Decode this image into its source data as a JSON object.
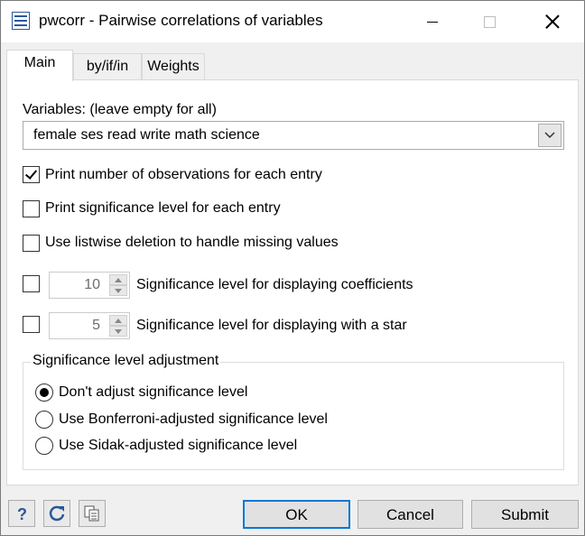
{
  "window": {
    "title": "pwcorr - Pairwise correlations of variables",
    "icons": [
      "app-icon",
      "minimize-icon",
      "maximize-icon",
      "close-icon"
    ]
  },
  "tabs": [
    {
      "label": "Main",
      "active": true
    },
    {
      "label": "by/if/in",
      "active": false
    },
    {
      "label": "Weights",
      "active": false
    }
  ],
  "main": {
    "variables_label": "Variables: (leave empty for all)",
    "variables_value": "female ses read write math science",
    "checkboxes": [
      {
        "label": "Print number of observations for each entry",
        "checked": true
      },
      {
        "label": "Print significance level for each entry",
        "checked": false
      },
      {
        "label": "Use listwise deletion to handle missing values",
        "checked": false
      }
    ],
    "spinners": [
      {
        "checked": false,
        "value": "10",
        "label": "Significance level for displaying coefficients"
      },
      {
        "checked": false,
        "value": "5",
        "label": "Significance level for displaying with a star"
      }
    ],
    "adjustment": {
      "title": "Significance level adjustment",
      "options": [
        {
          "label": "Don't adjust significance level",
          "selected": true
        },
        {
          "label": "Use Bonferroni-adjusted significance level",
          "selected": false
        },
        {
          "label": "Use Sidak-adjusted significance level",
          "selected": false
        }
      ]
    }
  },
  "footer": {
    "icons": [
      "help-icon",
      "reset-icon",
      "copy-icon"
    ],
    "ok_label": "OK",
    "cancel_label": "Cancel",
    "submit_label": "Submit"
  },
  "colors": {
    "accent": "#0078d7",
    "icon_blue": "#2b579a"
  }
}
